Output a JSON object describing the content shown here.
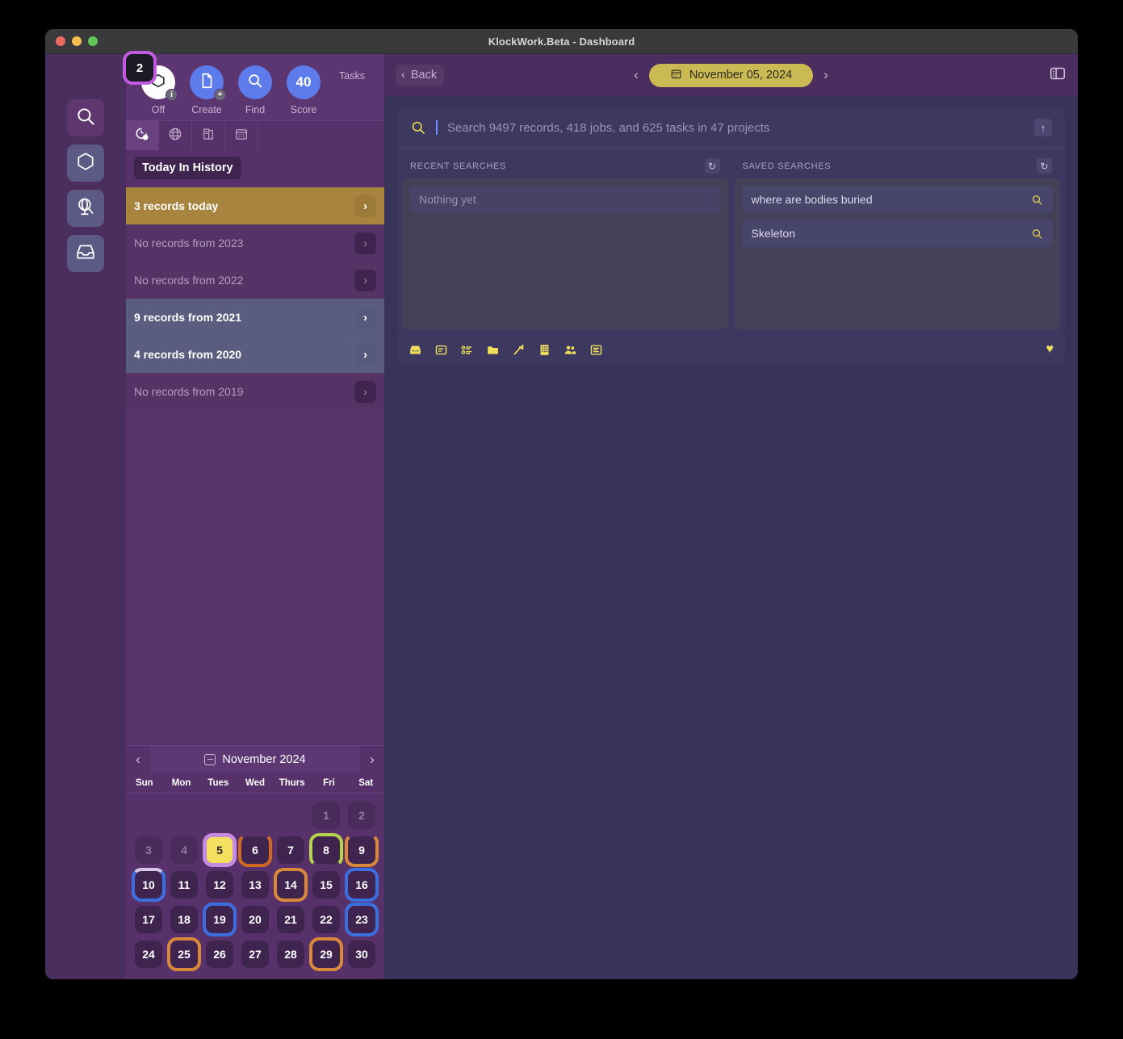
{
  "window": {
    "title": "KlockWork.Beta - Dashboard",
    "traffic_lights": [
      "close",
      "minimize",
      "zoom"
    ]
  },
  "rail": {
    "items": [
      {
        "name": "search",
        "icon": "magnifier-icon",
        "active": true
      },
      {
        "name": "hexagon",
        "icon": "hexagon-icon",
        "active": false
      },
      {
        "name": "explore",
        "icon": "globe-stand-icon",
        "active": false
      },
      {
        "name": "inbox",
        "icon": "inbox-tray-icon",
        "active": false
      }
    ]
  },
  "quickbar": {
    "items": [
      {
        "label": "Off",
        "style": "white",
        "icon": "hexagon-icon",
        "badge": "i"
      },
      {
        "label": "Create",
        "style": "blue",
        "icon": "document-icon",
        "badge": "+"
      },
      {
        "label": "Find",
        "style": "blue",
        "icon": "magnifier-icon",
        "badge": ""
      },
      {
        "label": "Score",
        "style": "blue",
        "value": "40",
        "badge": ""
      },
      {
        "label": "Tasks",
        "style": "ring",
        "value": "2",
        "badge": ""
      }
    ]
  },
  "icon_row": [
    {
      "name": "clock-history-icon",
      "selected": true
    },
    {
      "name": "globe-icon",
      "selected": false
    },
    {
      "name": "notes-icon",
      "selected": false
    },
    {
      "name": "calendar-icon",
      "selected": false
    }
  ],
  "today_in_history": {
    "heading": "Today In History",
    "rows": [
      {
        "label": "3 records today",
        "style": "gold"
      },
      {
        "label": "No records from 2023",
        "style": "none"
      },
      {
        "label": "No records from 2022",
        "style": "none"
      },
      {
        "label": "9 records from 2021",
        "style": "slate"
      },
      {
        "label": "4 records from 2020",
        "style": "slate"
      },
      {
        "label": "No records from 2019",
        "style": "none"
      }
    ]
  },
  "calendar": {
    "month_label": "November 2024",
    "prev": "‹",
    "next": "›",
    "dow": [
      "Sun",
      "Mon",
      "Tues",
      "Wed",
      "Thurs",
      "Fri",
      "Sat"
    ],
    "leading_blanks": 5,
    "days": [
      {
        "n": "1",
        "state": "dim"
      },
      {
        "n": "2",
        "state": "dim"
      },
      {
        "n": "3",
        "state": "dim"
      },
      {
        "n": "4",
        "state": "dim"
      },
      {
        "n": "5",
        "state": "today",
        "ring": "violet"
      },
      {
        "n": "6",
        "state": "normal",
        "ring": "bot-orange"
      },
      {
        "n": "7",
        "state": "normal"
      },
      {
        "n": "8",
        "state": "normal",
        "ring": "top-green"
      },
      {
        "n": "9",
        "state": "normal",
        "ring": "bot-orange2"
      },
      {
        "n": "10",
        "state": "normal",
        "ring": "top-lav",
        "ring2": "bot-blue"
      },
      {
        "n": "11",
        "state": "normal"
      },
      {
        "n": "12",
        "state": "normal"
      },
      {
        "n": "13",
        "state": "normal"
      },
      {
        "n": "14",
        "state": "normal",
        "ring": "full-orange"
      },
      {
        "n": "15",
        "state": "normal"
      },
      {
        "n": "16",
        "state": "normal",
        "ring": "full-blue"
      },
      {
        "n": "17",
        "state": "normal"
      },
      {
        "n": "18",
        "state": "normal"
      },
      {
        "n": "19",
        "state": "normal",
        "ring": "full-blue"
      },
      {
        "n": "20",
        "state": "normal"
      },
      {
        "n": "21",
        "state": "normal"
      },
      {
        "n": "22",
        "state": "normal"
      },
      {
        "n": "23",
        "state": "normal",
        "ring": "full-blue"
      },
      {
        "n": "24",
        "state": "normal"
      },
      {
        "n": "25",
        "state": "normal",
        "ring": "full-orange"
      },
      {
        "n": "26",
        "state": "normal"
      },
      {
        "n": "27",
        "state": "normal"
      },
      {
        "n": "28",
        "state": "normal"
      },
      {
        "n": "29",
        "state": "normal",
        "ring": "full-orange"
      },
      {
        "n": "30",
        "state": "normal"
      }
    ]
  },
  "topbar": {
    "back_label": "Back",
    "back_chevron": "‹",
    "prev_day": "‹",
    "next_day": "›",
    "date_label": "November 05, 2024",
    "date_icon": "calendar-icon",
    "panel_toggle_icon": "sidebar-toggle-icon"
  },
  "search": {
    "placeholder": "Search 9497 records, 418 jobs, and 625 tasks in 47 projects",
    "value": "",
    "icon": "magnifier-icon",
    "submit_icon": "arrow-up-icon",
    "submit_glyph": "↑"
  },
  "recent_searches": {
    "title": "RECENT SEARCHES",
    "refresh_glyph": "↻",
    "items": [
      {
        "label": "Nothing yet",
        "placeholder": true
      }
    ]
  },
  "saved_searches": {
    "title": "SAVED SEARCHES",
    "refresh_glyph": "↻",
    "items": [
      {
        "label": "where are bodies buried",
        "placeholder": false
      },
      {
        "label": "Skeleton",
        "placeholder": false
      }
    ]
  },
  "bottom_toolbar": {
    "items": [
      "inbox-icon",
      "note-card-icon",
      "checklist-icon",
      "folder-icon",
      "hammer-icon",
      "building-icon",
      "people-icon",
      "list-icon"
    ],
    "favorite_icon": "heart-icon",
    "favorite_glyph": "♥"
  },
  "colors": {
    "accent_gold": "#cbba53",
    "accent_yellow": "#efdf5c",
    "purple_panel": "#58336b",
    "main_bg": "#383358",
    "blue": "#5d7bea",
    "task_ring": "#c05ae0",
    "gold_row": "#a8853f",
    "slate_row": "#5b5d80"
  }
}
